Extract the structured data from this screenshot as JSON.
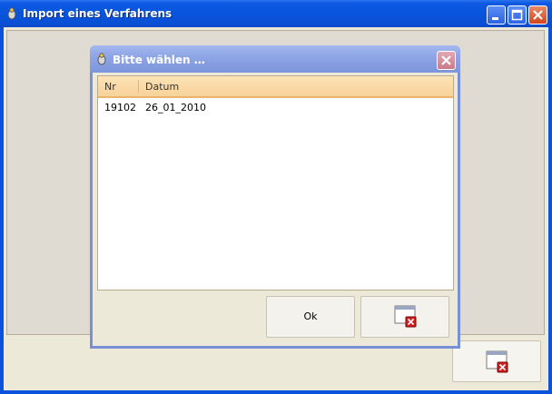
{
  "window": {
    "title": "Import eines Verfahrens"
  },
  "dialog": {
    "title": "Bitte wählen …",
    "table": {
      "columns": [
        "Nr",
        "Datum"
      ],
      "rows": [
        {
          "nr": "19102",
          "datum": "26_01_2010"
        }
      ]
    },
    "ok_label": "Ok",
    "cancel_icon": "window-cancel-icon"
  },
  "main_cancel_icon": "window-cancel-icon",
  "colors": {
    "titlebar": "#0854dc",
    "dialog_titlebar": "#8ea6e6",
    "header_bg": "#fde3b6",
    "close_red": "#d3441c"
  }
}
